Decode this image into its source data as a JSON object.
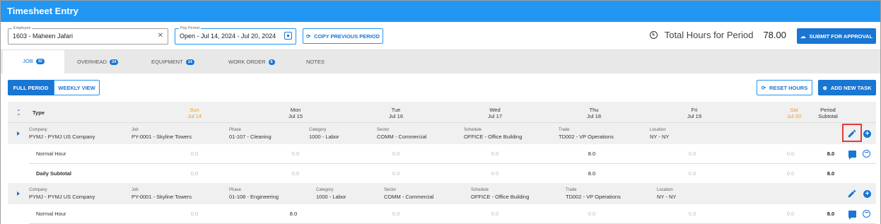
{
  "app": {
    "title": "Timesheet Entry"
  },
  "toolbar": {
    "employee_label": "Employee",
    "employee_value": "1603 - Maheen Jafari",
    "pay_period_label": "Pay Period",
    "pay_period_value": "Open - Jul 14, 2024 - Jul 20, 2024",
    "copy_previous": "COPY PREVIOUS PERIOD",
    "total_label": "Total Hours for Period",
    "total_value": "78.00",
    "submit": "SUBMIT FOR APPROVAL"
  },
  "tabs": [
    {
      "label": "JOB",
      "badge": "32"
    },
    {
      "label": "OVERHEAD",
      "badge": "24"
    },
    {
      "label": "EQUIPMENT",
      "badge": "14"
    },
    {
      "label": "WORK ORDER",
      "badge": "8"
    },
    {
      "label": "NOTES",
      "badge": ""
    }
  ],
  "view": {
    "full_period": "FULL PERIOD",
    "weekly_view": "WEEKLY VIEW",
    "reset_hours": "RESET HOURS",
    "add_new_task": "ADD NEW TASK"
  },
  "grid": {
    "type_header": "Type",
    "days": [
      {
        "dow": "Sun",
        "date": "Jul 14",
        "weekend": true
      },
      {
        "dow": "Mon",
        "date": "Jul 15",
        "weekend": false
      },
      {
        "dow": "Tue",
        "date": "Jul 16",
        "weekend": false
      },
      {
        "dow": "Wed",
        "date": "Jul 17",
        "weekend": false
      },
      {
        "dow": "Thu",
        "date": "Jul 18",
        "weekend": false
      },
      {
        "dow": "Fri",
        "date": "Jul 19",
        "weekend": false
      },
      {
        "dow": "Sat",
        "date": "Jul 20",
        "weekend": true
      }
    ],
    "period_h1": "Period",
    "period_h2": "Subtotal"
  },
  "tasks": [
    {
      "fields": [
        {
          "k": "Company",
          "v": "PYMJ - PYMJ US Company"
        },
        {
          "k": "Job",
          "v": "PY-0001 - Skyline Towers"
        },
        {
          "k": "Phase",
          "v": "01-107 - Cleaning"
        },
        {
          "k": "Category",
          "v": "1000 - Labor"
        },
        {
          "k": "Sector",
          "v": "COMM - Commercial"
        },
        {
          "k": "Schedule",
          "v": "OFFICE - Office Building"
        },
        {
          "k": "Trade",
          "v": "TD002 - VP Operations"
        },
        {
          "k": "Location",
          "v": "NY - NY"
        }
      ],
      "hours_label": "Normal Hour",
      "hours": [
        "0.0",
        "0.0",
        "0.0",
        "0.0",
        "8.0",
        "0.0",
        "0.0"
      ],
      "hours_total": "8.0",
      "subtotal_label": "Daily Subtotal",
      "subtotal": [
        "0.0",
        "0.0",
        "0.0",
        "0.0",
        "8.0",
        "0.0",
        "0.0"
      ],
      "subtotal_total": "8.0"
    },
    {
      "fields": [
        {
          "k": "Company",
          "v": "PYMJ - PYMJ US Company"
        },
        {
          "k": "Job",
          "v": "PY-0001 - Skyline Towers"
        },
        {
          "k": "Phase",
          "v": "01-108 - Engineering"
        },
        {
          "k": "Category",
          "v": "1000 - Labor"
        },
        {
          "k": "Sector",
          "v": "COMM - Commercial"
        },
        {
          "k": "Schedule",
          "v": "OFFICE - Office Building"
        },
        {
          "k": "Trade",
          "v": "TD002 - VP Operations"
        },
        {
          "k": "Location",
          "v": "NY - NY"
        }
      ],
      "hours_label": "Normal Hour",
      "hours": [
        "0.0",
        "8.0",
        "0.0",
        "0.0",
        "0.0",
        "0.0",
        "0.0"
      ],
      "hours_total": "8.0"
    }
  ],
  "colors": {
    "primary": "#1976d2",
    "header": "#2196f3",
    "weekend": "#f29a1e",
    "highlight": "#e53935"
  }
}
